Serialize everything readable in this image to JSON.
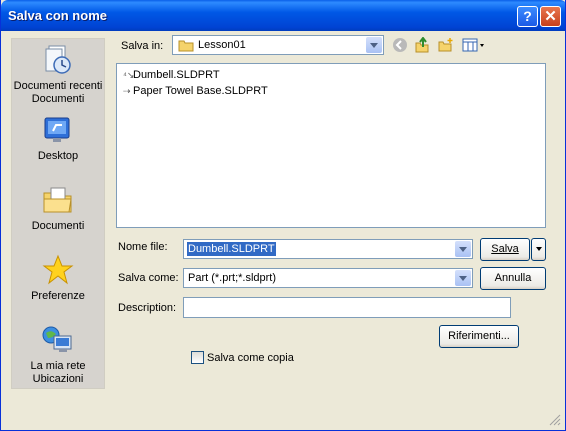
{
  "window": {
    "title": "Salva con nome"
  },
  "places": [
    {
      "label": "Documenti recenti",
      "label2": "Documenti",
      "icon": "recent-documents-icon"
    },
    {
      "label": "Desktop",
      "icon": "desktop-icon"
    },
    {
      "label": "Documenti",
      "icon": "documents-folder-icon"
    },
    {
      "label": "Preferenze",
      "icon": "favorites-star-icon"
    },
    {
      "label": "La mia rete",
      "label2": "Ubicazioni",
      "icon": "network-icon"
    }
  ],
  "save_in": {
    "label": "Salva in:",
    "value": "Lesson01"
  },
  "files": [
    {
      "name": "Dumbell.SLDPRT",
      "icon": "sw-part-icon"
    },
    {
      "name": "Paper Towel Base.SLDPRT",
      "icon": "sw-part-icon"
    }
  ],
  "filename": {
    "label": "Nome file:",
    "value": "Dumbell.SLDPRT"
  },
  "save_as": {
    "label": "Salva come:",
    "value": "Part (*.prt;*.sldprt)"
  },
  "description": {
    "label": "Description:",
    "value": ""
  },
  "buttons": {
    "save": "Salva",
    "cancel": "Annulla",
    "references": "Riferimenti..."
  },
  "checkbox": {
    "label": "Salva come copia",
    "checked": false
  }
}
